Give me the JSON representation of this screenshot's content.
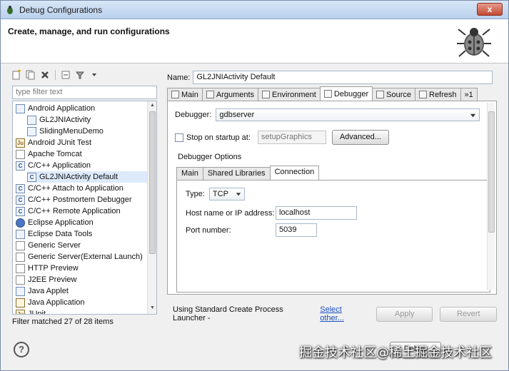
{
  "window": {
    "title": "Debug Configurations",
    "close_label": "x"
  },
  "header": {
    "title": "Create, manage, and run configurations"
  },
  "left": {
    "filter_placeholder": "type filter text",
    "tree": [
      {
        "label": "Android Application",
        "icon": "android-app-icon",
        "level": 0
      },
      {
        "label": "GL2JNIActivity",
        "icon": "android-config-icon",
        "level": 1
      },
      {
        "label": "SlidingMenuDemo",
        "icon": "android-config-icon",
        "level": 1
      },
      {
        "label": "Android JUnit Test",
        "icon": "junit-icon",
        "level": 0
      },
      {
        "label": "Apache Tomcat",
        "icon": "tomcat-icon",
        "level": 0
      },
      {
        "label": "C/C++ Application",
        "icon": "c-app-icon",
        "level": 0
      },
      {
        "label": "GL2JNIActivity Default",
        "icon": "c-config-icon",
        "level": 1,
        "selected": true
      },
      {
        "label": "C/C++ Attach to Application",
        "icon": "c-app-icon",
        "level": 0
      },
      {
        "label": "C/C++ Postmortem Debugger",
        "icon": "c-app-icon",
        "level": 0
      },
      {
        "label": "C/C++ Remote Application",
        "icon": "c-app-icon",
        "level": 0
      },
      {
        "label": "Eclipse Application",
        "icon": "eclipse-icon",
        "level": 0
      },
      {
        "label": "Eclipse Data Tools",
        "icon": "data-tools-icon",
        "level": 0
      },
      {
        "label": "Generic Server",
        "icon": "server-icon",
        "level": 0
      },
      {
        "label": "Generic Server(External Launch)",
        "icon": "server-icon",
        "level": 0
      },
      {
        "label": "HTTP Preview",
        "icon": "server-icon",
        "level": 0
      },
      {
        "label": "J2EE Preview",
        "icon": "server-icon",
        "level": 0
      },
      {
        "label": "Java Applet",
        "icon": "applet-icon",
        "level": 0
      },
      {
        "label": "Java Application",
        "icon": "java-app-icon",
        "level": 0
      },
      {
        "label": "JUnit",
        "icon": "junit-icon",
        "level": 0
      }
    ],
    "status": "Filter matched 27 of 28 items"
  },
  "right": {
    "name_label": "Name:",
    "name_value": "GL2JNIActivity Default",
    "tabs": [
      {
        "label": "Main",
        "icon": "main-tab-icon"
      },
      {
        "label": "Arguments",
        "icon": "arguments-tab-icon"
      },
      {
        "label": "Environment",
        "icon": "environment-tab-icon"
      },
      {
        "label": "Debugger",
        "icon": "debugger-tab-icon",
        "active": true
      },
      {
        "label": "Source",
        "icon": "source-tab-icon"
      },
      {
        "label": "Refresh",
        "icon": "refresh-tab-icon"
      }
    ],
    "tabs_overflow": "»1",
    "debugger_label": "Debugger:",
    "debugger_value": "gdbserver",
    "stop_label": "Stop on startup at:",
    "stop_value": "setupGraphics",
    "advanced_label": "Advanced...",
    "options_label": "Debugger Options",
    "subtabs": [
      "Main",
      "Shared Libraries",
      "Connection"
    ],
    "type_label": "Type:",
    "type_value": "TCP",
    "host_label": "Host name or IP address:",
    "host_value": "localhost",
    "port_label": "Port number:",
    "port_value": "5039",
    "launcher_text": "Using Standard Create Process Launcher -",
    "launcher_link": "Select other...",
    "apply_label": "Apply",
    "revert_label": "Revert"
  },
  "footer": {
    "help_label": "?",
    "debug_label": "Debug",
    "watermark": "掘金技术社区@稀土掘金技术社区"
  }
}
